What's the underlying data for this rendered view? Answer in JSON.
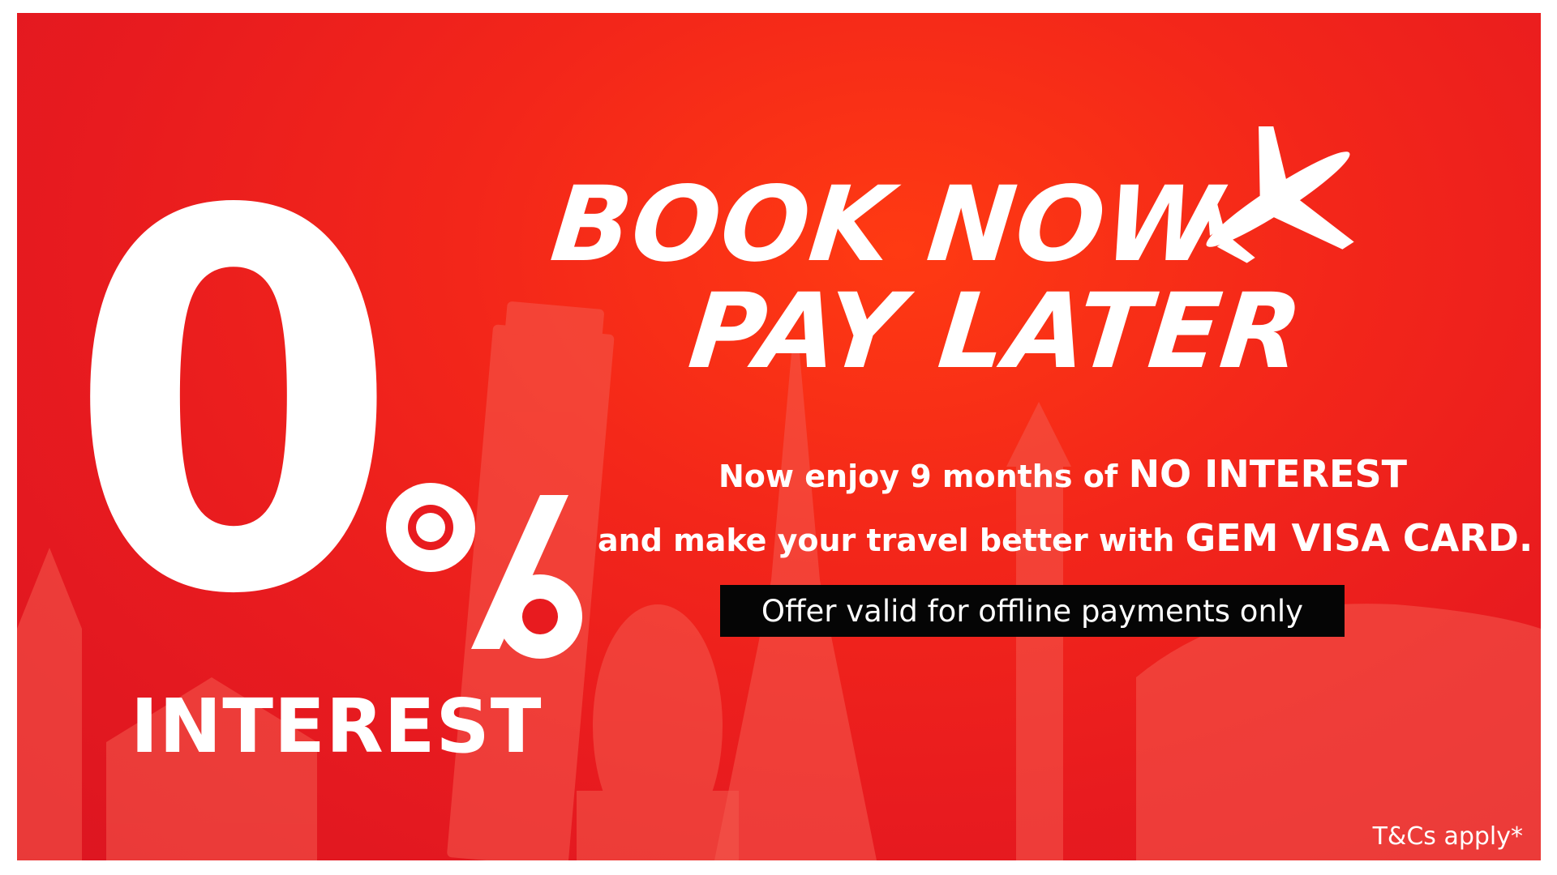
{
  "banner": {
    "zero": "0",
    "interest_label": "INTEREST",
    "headline_line1": "BOOK NOW",
    "headline_line2": "PAY LATER",
    "line1_prefix": "Now enjoy 9 months of ",
    "line1_emphasis": "NO INTEREST",
    "line2_prefix": "and make your travel better with ",
    "line2_emphasis": "GEM VISA CARD.",
    "offer_note": "Offer valid for offline payments only",
    "terms": "T&Cs apply*"
  },
  "icons": {
    "plane": "airplane-icon",
    "percent": "percent-sign-icon",
    "landmarks": "landmark-silhouettes"
  },
  "colors": {
    "background": "#e81b1f",
    "background_glow": "#ff3a12",
    "text": "#ffffff",
    "offer_box": "#050505"
  }
}
